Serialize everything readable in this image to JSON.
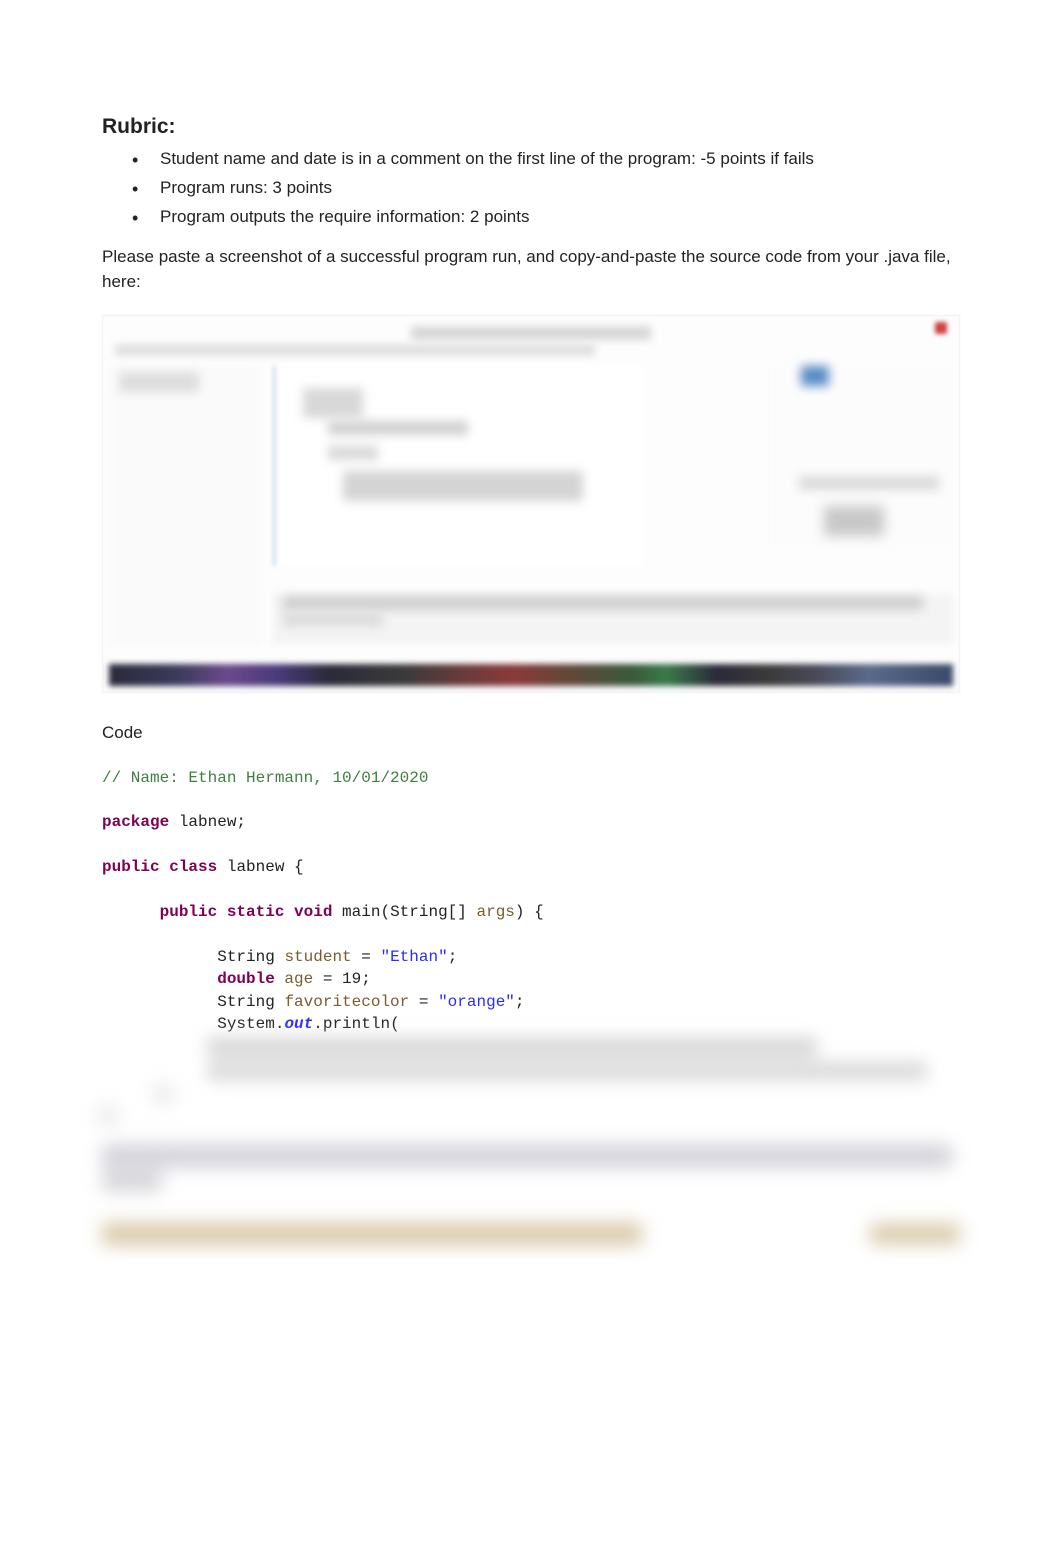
{
  "rubric": {
    "heading": "Rubric:",
    "items": [
      "Student name and date is in a comment on the first line of the program: -5 points if fails",
      "Program runs: 3 points",
      "Program outputs the require information: 2 points"
    ],
    "instruction": "Please paste a screenshot of a successful program run, and copy-and-paste the source code from your .java file, here:"
  },
  "code": {
    "label": "Code",
    "comment": "// Name: Ethan Hermann, 10/01/2020",
    "package_kw": "package",
    "package_name": " labnew;",
    "public_kw": "public",
    "class_kw": "class",
    "class_name": " labnew {",
    "static_kw": "static",
    "void_kw": "void",
    "main_sig_1": " main(String[] ",
    "args": "args",
    "main_sig_2": ") {",
    "string_type": "String ",
    "student_var": "student",
    "eq": " = ",
    "student_val": "\"Ethan\"",
    "semicolon": ";",
    "double_kw": "double",
    "age_var": " age",
    "age_val": " = 19;",
    "favcolor_var": "favoritecolor",
    "favcolor_val": "\"orange\"",
    "system": "System.",
    "out": "out",
    "println": ".println("
  }
}
